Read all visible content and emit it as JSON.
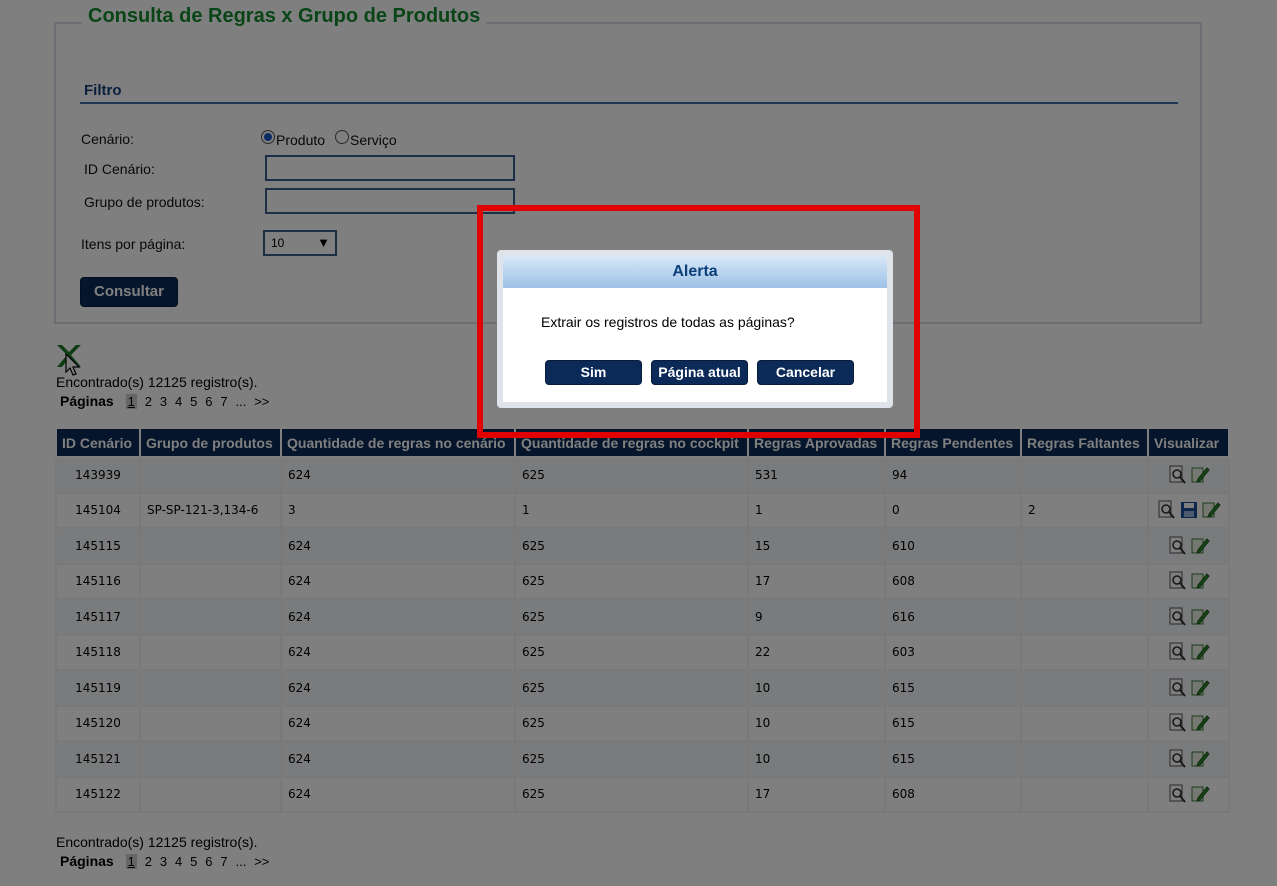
{
  "page": {
    "title": "Consulta de Regras x Grupo de Produtos",
    "filter_title": "Filtro"
  },
  "form": {
    "cenario_label": "Cenário:",
    "radio_produto": "Produto",
    "radio_servico": "Serviço",
    "id_cenario_label": "ID Cenário:",
    "id_cenario_value": "",
    "grupo_label": "Grupo de produtos:",
    "grupo_value": "",
    "itens_label": "Itens por página:",
    "itens_value": "10",
    "consultar_label": "Consultar"
  },
  "results": {
    "found_text": "Encontrado(s) 12125 registro(s).",
    "pages_label": "Páginas",
    "page_numbers": [
      "1",
      "2",
      "3",
      "4",
      "5",
      "6",
      "7",
      "...",
      ">>"
    ]
  },
  "table": {
    "headers": [
      "ID Cenário",
      "Grupo de produtos",
      "Quantidade de regras no cenário",
      "Quantidade de regras no cockpit",
      "Regras Aprovadas",
      "Regras Pendentes",
      "Regras Faltantes",
      "Visualizar"
    ],
    "rows": [
      [
        "143939",
        "",
        "624",
        "625",
        "531",
        "94",
        ""
      ],
      [
        "145104",
        "SP-SP-121-3,134-6",
        "3",
        "1",
        "1",
        "0",
        "2"
      ],
      [
        "145115",
        "",
        "624",
        "625",
        "15",
        "610",
        ""
      ],
      [
        "145116",
        "",
        "624",
        "625",
        "17",
        "608",
        ""
      ],
      [
        "145117",
        "",
        "624",
        "625",
        "9",
        "616",
        ""
      ],
      [
        "145118",
        "",
        "624",
        "625",
        "22",
        "603",
        ""
      ],
      [
        "145119",
        "",
        "624",
        "625",
        "10",
        "615",
        ""
      ],
      [
        "145120",
        "",
        "624",
        "625",
        "10",
        "615",
        ""
      ],
      [
        "145121",
        "",
        "624",
        "625",
        "10",
        "615",
        ""
      ],
      [
        "145122",
        "",
        "624",
        "625",
        "17",
        "608",
        ""
      ]
    ]
  },
  "modal": {
    "title": "Alerta",
    "message": "Extrair os registros de todas as páginas?",
    "btn_sim": "Sim",
    "btn_pagina": "Página atual",
    "btn_cancelar": "Cancelar"
  },
  "icons": {
    "excel": "excel-export-icon",
    "view": "magnifier-icon",
    "edit": "edit-icon",
    "save": "save-icon"
  }
}
